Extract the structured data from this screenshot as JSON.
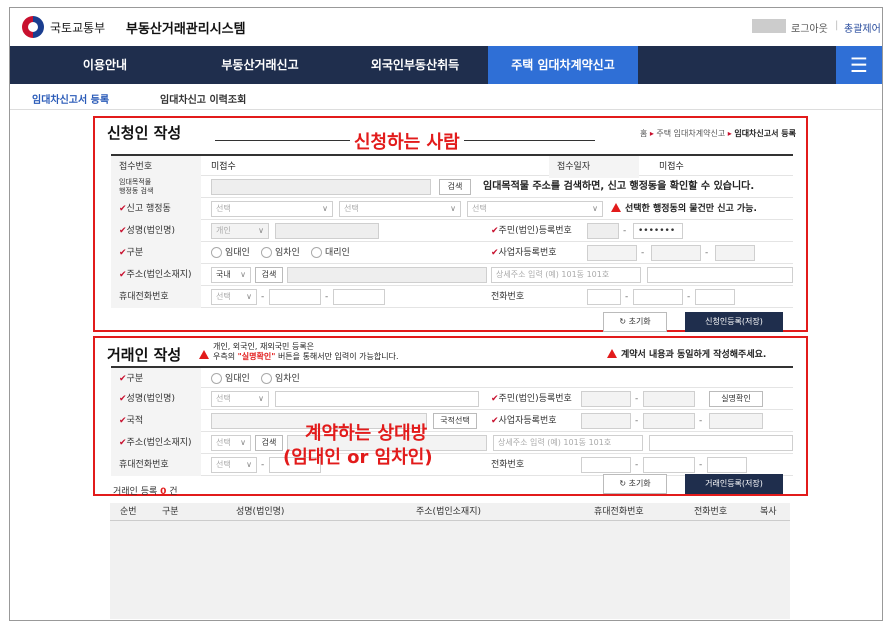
{
  "header": {
    "ministry": "국토교통부",
    "system_name": "부동산거래관리시스템",
    "logout": "로그아웃",
    "sitemap": "총괄제어"
  },
  "nav": {
    "items": [
      {
        "label": "이용안내"
      },
      {
        "label": "부동산거래신고"
      },
      {
        "label": "외국인부동산취득"
      },
      {
        "label": "주택 임대차계약신고"
      }
    ],
    "active_index": 3,
    "menu_icon": "hamburger-icon"
  },
  "subtabs": [
    {
      "label": "임대차신고서 등록"
    },
    {
      "label": "임대차신고 이력조회"
    }
  ],
  "applicant": {
    "title": "신청인 작성",
    "annotation": "신청하는 사람",
    "breadcrumb": {
      "home": "홈",
      "mid": "주택 임대차계약신고",
      "current": "임대차신고서 등록"
    },
    "receipt_no_label": "접수번호",
    "receipt_no_value": "미접수",
    "receipt_date_label": "접수일자",
    "receipt_date_value": "미접수",
    "search_label_1": "임대목적물",
    "search_label_2": "행정동 검색",
    "search_button": "검색",
    "search_note": "임대목적물 주소를 검색하면, 신고 행정동을 확인할 수 있습니다.",
    "dong_label": "신고 행정동",
    "select_placeholder": "선택",
    "dong_warning": "선택한 행정동의 물건만 신고 가능.",
    "name_label": "성명(법인명)",
    "name_type": "개인",
    "rrn_label": "주민(법인)등록번호",
    "rrn_masked": "•••••••",
    "type_label": "구분",
    "radio_options": [
      "임대인",
      "임차인",
      "대리인"
    ],
    "bizno_label": "사업자등록번호",
    "addr_label": "주소(법인소재지)",
    "addr_domestic": "국내",
    "addr_search": "검색",
    "addr_detail_placeholder": "상세주소 입력 (예) 101동 101호",
    "mobile_label": "휴대전화번호",
    "phone_label": "전화번호",
    "dash": "-",
    "reset_button": "초기화",
    "save_button": "신청인등록(저장)"
  },
  "counterparty": {
    "title": "거래인 작성",
    "notice_line1": "개인, 외국인, 재외국민 등록은",
    "notice_line2_pre": "우측의 ",
    "notice_line2_red": "\"실명확인\"",
    "notice_line2_post": " 버튼을 통해서만 입력이 가능합니다.",
    "right_warning": "계약서 내용과 동일하게 작성해주세요.",
    "annotation_line1": "계약하는 상대방",
    "annotation_line2": "(임대인 or 임차인)",
    "type_label": "구분",
    "radio_options": [
      "임대인",
      "임차인"
    ],
    "name_label": "성명(법인명)",
    "select_placeholder": "선택",
    "rrn_label": "주민(법인)등록번호",
    "realname_button": "실명확인",
    "nationality_label": "국적",
    "nationality_button": "국적선택",
    "bizno_label": "사업자등록번호",
    "addr_label": "주소(법인소재지)",
    "addr_search": "검색",
    "addr_detail_placeholder": "상세주소 입력 (예) 101동 101호",
    "mobile_label": "휴대전화번호",
    "phone_label": "전화번호",
    "dash": "-",
    "count_pre": "거래인 등록 ",
    "count_value": "0",
    "count_post": " 건",
    "reset_button": "초기화",
    "save_button": "거래인등록(저장)"
  },
  "table": {
    "columns": [
      "순번",
      "구분",
      "성명(법인명)",
      "주소(법인소재지)",
      "휴대전화번호",
      "전화번호",
      "복사"
    ]
  },
  "colors": {
    "nav_bg": "#1f2e4d",
    "accent": "#2f6fd6",
    "annotation_red": "#e21b1b"
  }
}
